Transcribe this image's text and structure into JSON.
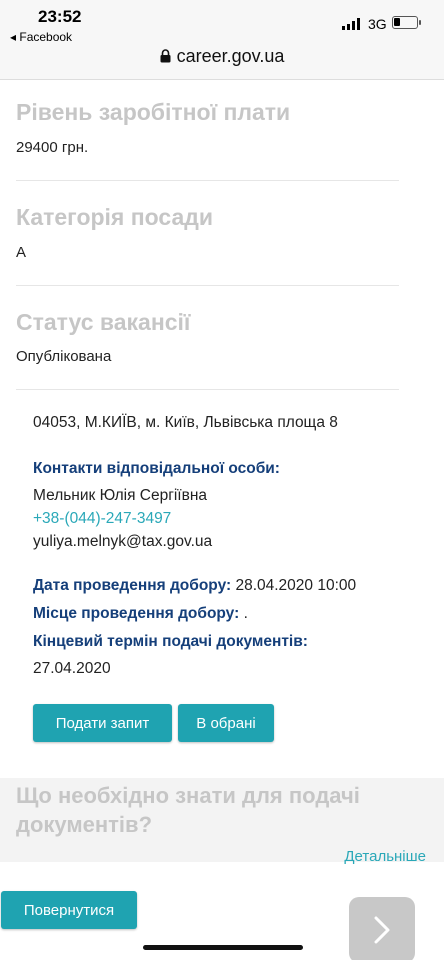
{
  "status_bar": {
    "time": "23:52",
    "back_app": "◂ Facebook",
    "network": "3G"
  },
  "browser": {
    "url": "career.gov.ua"
  },
  "salary": {
    "title": "Рівень заробітної плати",
    "value": "29400 грн."
  },
  "category": {
    "title": "Категорія посади",
    "value": "А"
  },
  "status": {
    "title": "Статус вакансії",
    "value": "Опублікована"
  },
  "address": "04053, М.КИЇВ, м. Київ, Львівська площа 8",
  "contacts": {
    "label": "Контакти відповідальної особи:",
    "name": "Мельник Юлія Сергіївна",
    "phone": "+38-(044)-247-3497",
    "email": "yuliya.melnyk@tax.gov.ua"
  },
  "selection": {
    "date_label": "Дата проведення добору:",
    "date_value": " 28.04.2020 10:00",
    "place_label": "Місце проведення добору:",
    "place_value": " .",
    "deadline_label": "Кінцевий термін подачі документів:",
    "deadline_value": "27.04.2020"
  },
  "actions": {
    "apply": "Подати запит",
    "favorite": "В обрані"
  },
  "info_block": {
    "title": "Що необхідно знати для подачі документів?",
    "details_link": "Детальніше"
  },
  "nav": {
    "back": "Повернутися"
  }
}
